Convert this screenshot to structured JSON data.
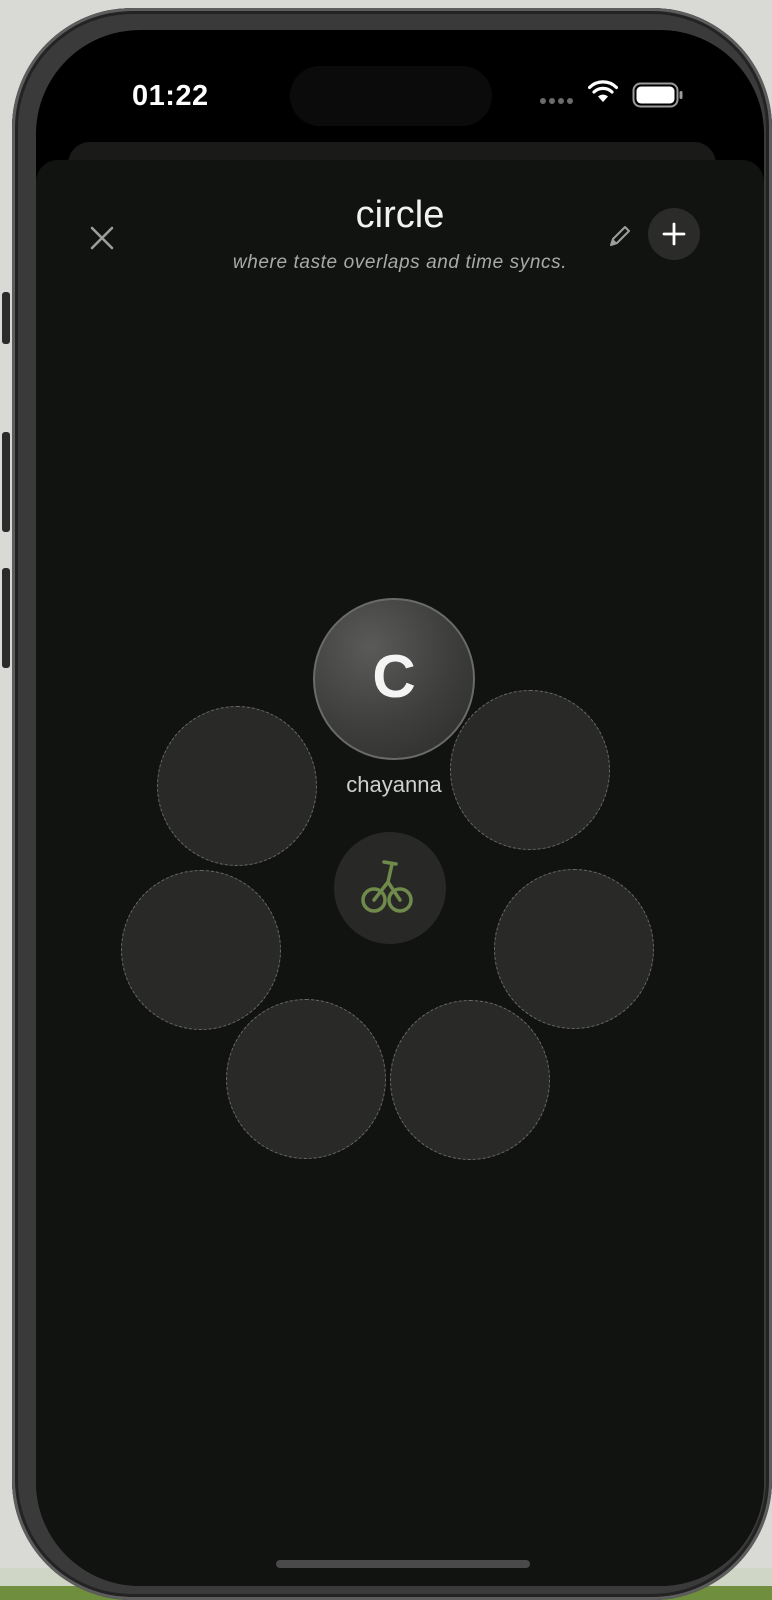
{
  "status_bar": {
    "time": "01:22",
    "icons": [
      "cellular-signal-icon",
      "wifi-icon",
      "battery-icon"
    ]
  },
  "header": {
    "title": "circle",
    "subtitle": "where taste overlaps and time syncs.",
    "icons": {
      "close": "close-icon",
      "edit": "pencil-icon",
      "add": "plus-icon"
    }
  },
  "circle": {
    "member": {
      "initial": "C",
      "name": "chayanna"
    },
    "center_icon": "bicycle-icon",
    "empty_slots": 6
  },
  "colors": {
    "background": "#111311",
    "slot": "#292a27",
    "accent": "#6f8a4a",
    "text": "#f2f2f2",
    "muted_text": "#a9a9a9"
  }
}
